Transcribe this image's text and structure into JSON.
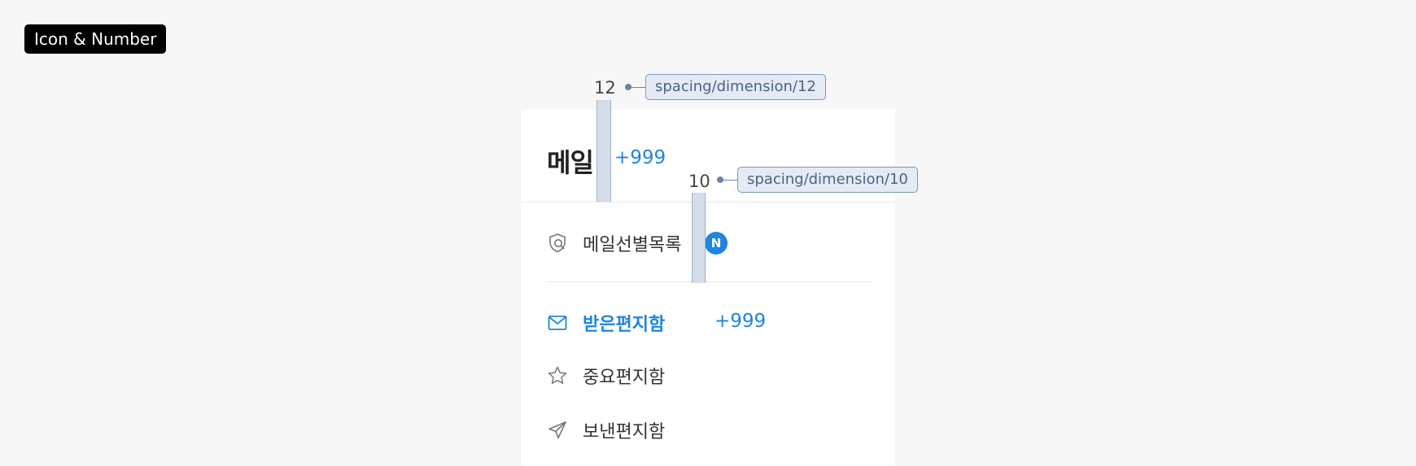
{
  "tag": {
    "label": "Icon & Number"
  },
  "panel": {
    "title": "메일",
    "title_count": "+999",
    "items": [
      {
        "label": "메일선별목록",
        "icon": "shield-search-icon",
        "badge": "N"
      },
      {
        "label": "받은편지함",
        "icon": "envelope-icon",
        "count": "+999",
        "active": true
      },
      {
        "label": "중요편지함",
        "icon": "star-icon"
      },
      {
        "label": "보낸편지함",
        "icon": "paper-plane-icon"
      }
    ]
  },
  "annotations": [
    {
      "value": "12",
      "token": "spacing/dimension/12"
    },
    {
      "value": "10",
      "token": "spacing/dimension/10"
    }
  ],
  "colors": {
    "accent": "#1f85e0",
    "background": "#f7f7f7",
    "panel": "#ffffff",
    "annotation_fill": "#e4ebf5",
    "annotation_border": "#7e96b8",
    "tag": "#000000"
  }
}
